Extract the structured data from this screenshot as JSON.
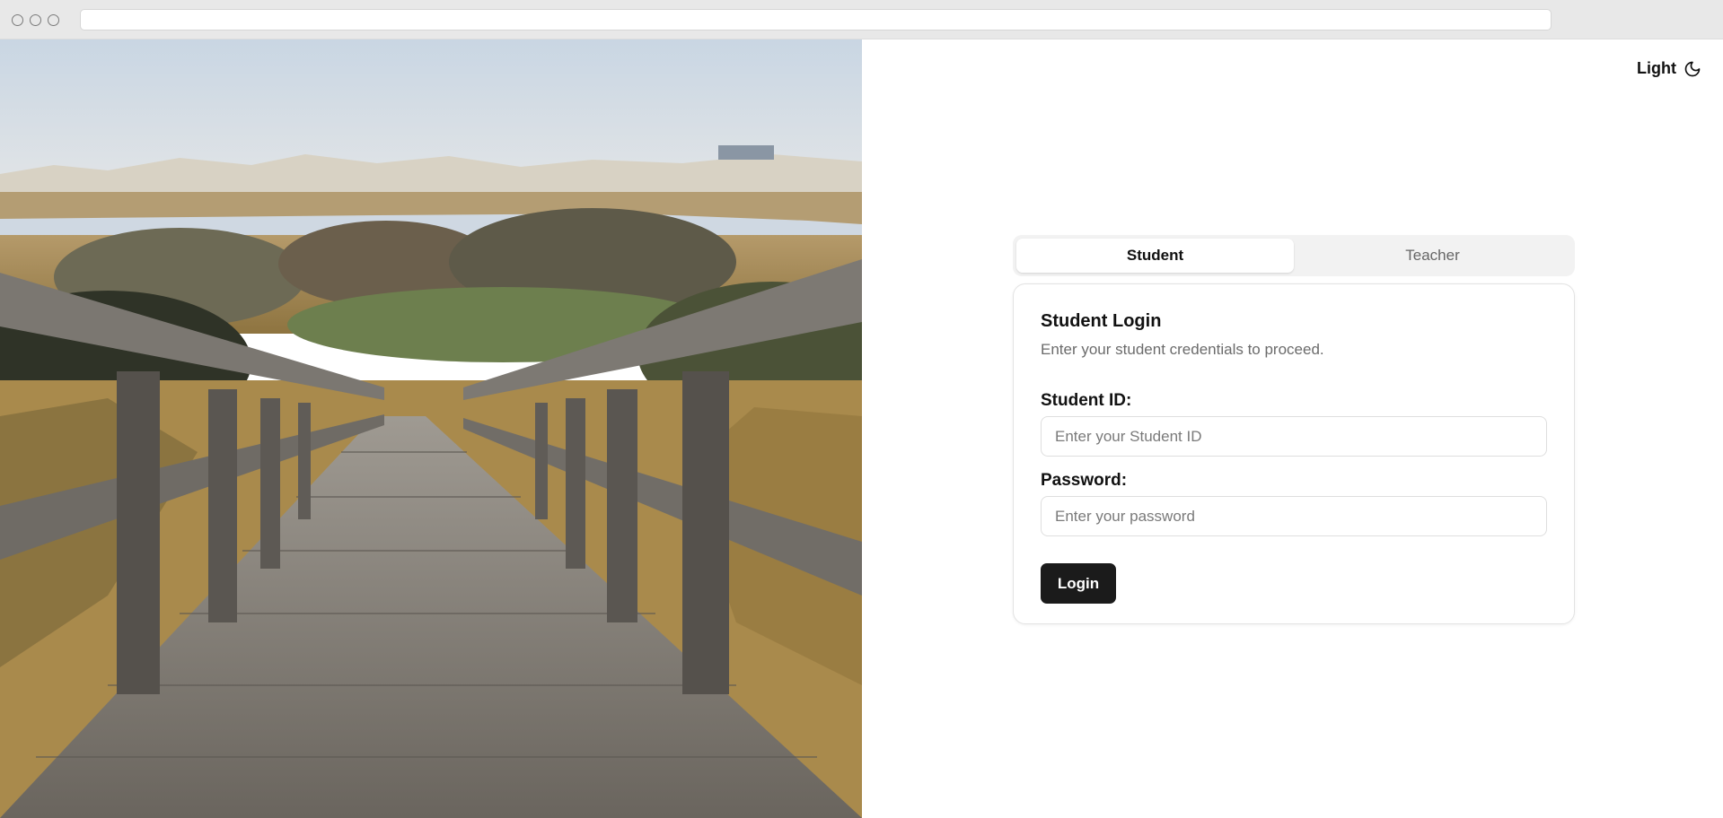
{
  "theme_toggle": {
    "label": "Light",
    "icon": "moon-icon"
  },
  "tabs": [
    {
      "label": "Student",
      "active": true
    },
    {
      "label": "Teacher",
      "active": false
    }
  ],
  "login_card": {
    "title": "Student Login",
    "subtitle": "Enter your student credentials to proceed.",
    "student_id": {
      "label": "Student ID:",
      "value": "",
      "placeholder": "Enter your Student ID"
    },
    "password": {
      "label": "Password:",
      "value": "",
      "placeholder": "Enter your password"
    },
    "submit_label": "Login"
  },
  "colors": {
    "button_bg": "#1b1b1b",
    "tab_track": "#f2f2f2",
    "muted_text": "#6b6b6b"
  }
}
